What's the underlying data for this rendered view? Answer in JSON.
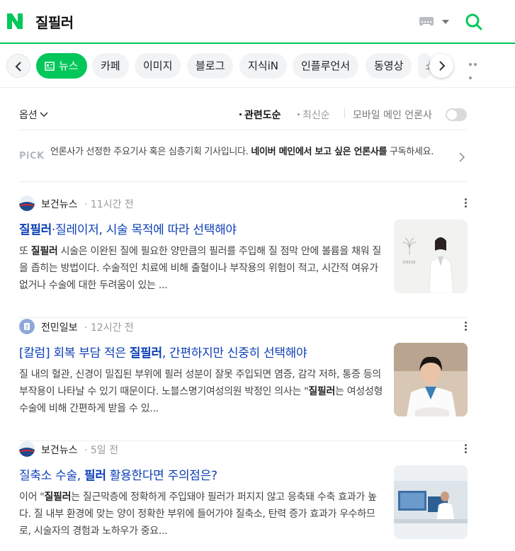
{
  "search": {
    "query": "질필러"
  },
  "tabs": [
    {
      "label": "뉴스",
      "active": true
    },
    {
      "label": "카페"
    },
    {
      "label": "이미지"
    },
    {
      "label": "블로그"
    },
    {
      "label": "지식iN"
    },
    {
      "label": "인플루언서"
    },
    {
      "label": "동영상"
    },
    {
      "label": "쇼"
    }
  ],
  "options": {
    "option_label": "옵션",
    "sort_relevance": "관련도순",
    "sort_latest": "최신순",
    "mobile_main_press": "모바일 메인 언론사"
  },
  "pick": {
    "logo_text": "PiCK",
    "text_before": "언론사가 선정한 주요기사 혹은 심층기획 기사입니다. ",
    "text_bold": "네이버 메인에서 보고 싶은 언론사를",
    "text_after": " 구독하세요."
  },
  "articles": [
    {
      "press": "보건뉴스",
      "time": "· 11시간 전",
      "title_bold": "질필러",
      "title_rest": "·질레이저, 시술 목적에 따라 선택해야",
      "desc_before": "또 ",
      "desc_bold": "질필러",
      "desc_after": " 시술은 이완된 질에 필요한 양만큼의 필러를 주입해 질 점막 안에 볼륨을 채워 질을 좁히는 방법이다. 수술적인 치료에 비해 출혈이나 부작용의 위험이 적고, 시간적 여유가 없거나 수술에 대한 두려움이 있는 ...",
      "thumb_text": "SINSOE"
    },
    {
      "press": "전민일보",
      "time": "· 12시간 전",
      "title_prefix": "[칼럼] 회복 부담 적은 ",
      "title_bold": "질필러",
      "title_rest": ", 간편하지만 신중히 선택해야",
      "desc_before": "질 내의 혈관, 신경이 밀집된 부위에 필러 성분이 잘못 주입되면 염증, 감각 저하, 통증 등의 부작용이 나타날 수 있기 때문이다. 노블스명기여성의원 박정인 의사는 \"",
      "desc_bold": "질필러",
      "desc_after": "는 여성성형수술에 비해 간편하게 받을 수 있..."
    },
    {
      "press": "보건뉴스",
      "time": "· 5일 전",
      "title_prefix": "질축소 수술, ",
      "title_bold": "필러",
      "title_rest": " 활용한다면 주의점은?",
      "desc_before": "이어 \"",
      "desc_bold": "질필러",
      "desc_after": "는 질근막층에 정확하게 주입돼야 필러가 퍼지지 않고 응축돼 수축 효과가 높다. 질 내부 환경에 맞는 양이 정확한 부위에 들어가야 질축소, 탄력 증가 효과가 우수하므로, 시술자의 경험과 노하우가 중요..."
    }
  ],
  "colors": {
    "brand": "#03c75a",
    "title_link": "#0c3fb5"
  }
}
